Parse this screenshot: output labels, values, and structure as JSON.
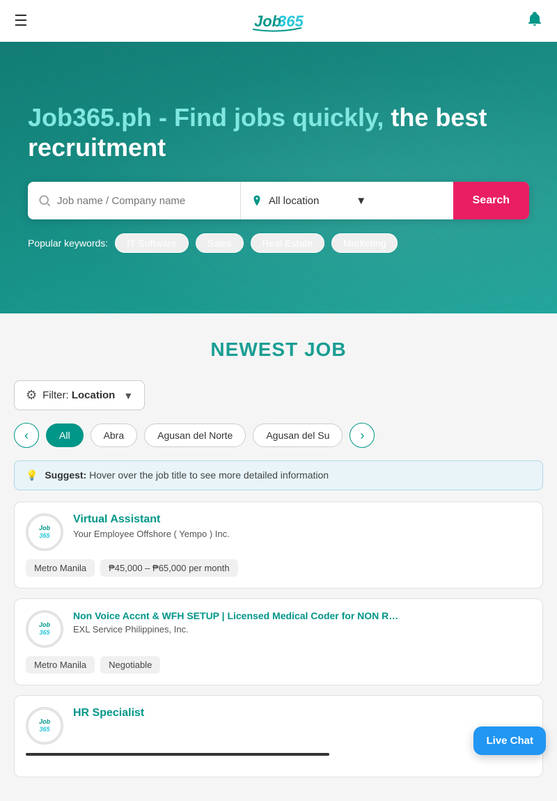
{
  "header": {
    "logo_text": "Job365",
    "menu_icon": "☰",
    "notification_icon": "🔔"
  },
  "hero": {
    "title_highlight": "Job365.ph - Find jobs quickly,",
    "title_white": " the best recruitment",
    "search": {
      "job_placeholder": "Job name / Company name",
      "location_value": "All location",
      "button_label": "Search"
    },
    "popular_label": "Popular keywords:",
    "keywords": [
      "IT Software",
      "Sales",
      "Real Estate",
      "Marketing"
    ]
  },
  "jobs_section": {
    "title": "NEWEST JOB",
    "filter_label": "Filter:",
    "filter_value": "Location",
    "suggest_text": "Hover over the job title to see more detailed information",
    "suggest_prefix": "Suggest:",
    "location_tabs": [
      "All",
      "Abra",
      "Agusan del Norte",
      "Agusan del Su"
    ],
    "jobs": [
      {
        "id": 1,
        "title": "Virtual Assistant",
        "company": "Your Employee Offshore ( Yempo ) Inc.",
        "location": "Metro Manila",
        "salary": "₱45,000 – ₱65,000 per month",
        "logo": "Job365"
      },
      {
        "id": 2,
        "title": "Non Voice Accnt & WFH SETUP | Licensed Medical Coder for NON R…",
        "company": "EXL Service Philippines, Inc.",
        "location": "Metro Manila",
        "salary": "Negotiable",
        "logo": "Job365"
      },
      {
        "id": 3,
        "title": "HR Specialist",
        "company": "",
        "location": "",
        "salary": "",
        "logo": "Job365"
      }
    ]
  },
  "live_chat": {
    "label": "Live Chat"
  }
}
